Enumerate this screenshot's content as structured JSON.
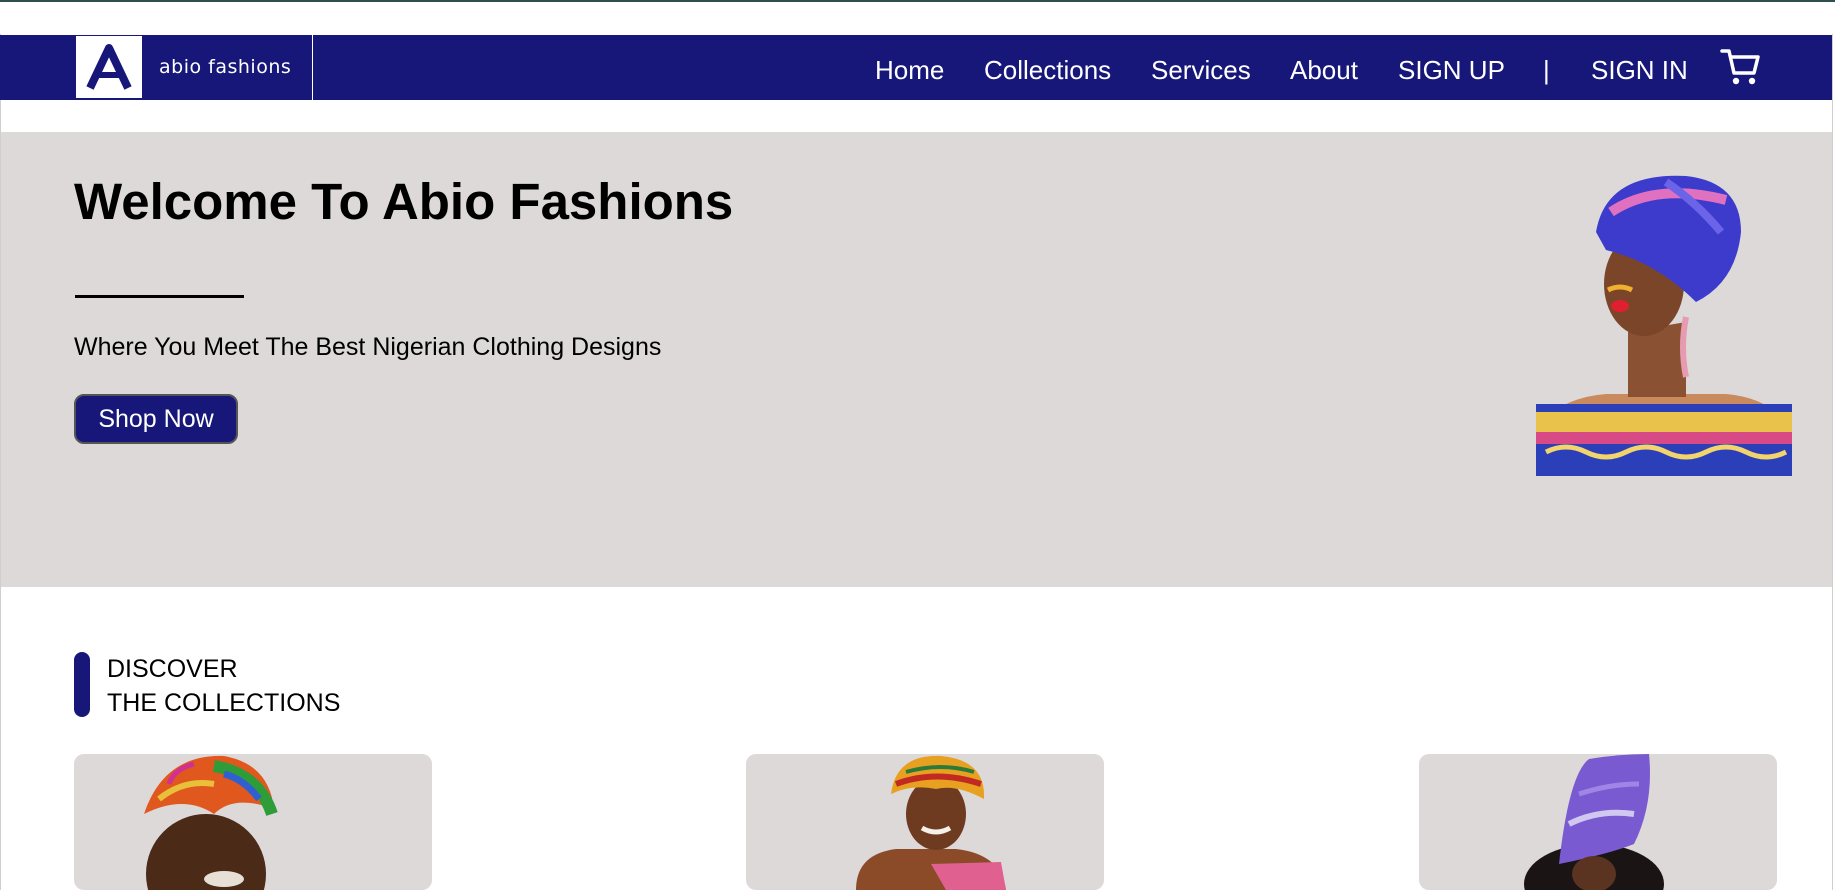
{
  "brand": {
    "logo_letter": "A",
    "name": "abio fashions"
  },
  "nav": {
    "home": "Home",
    "collections": "Collections",
    "services": "Services",
    "about": "About",
    "signup": "SIGN UP",
    "separator": "|",
    "signin": "SIGN IN",
    "cart_icon": "cart-icon"
  },
  "hero": {
    "title": "Welcome To Abio Fashions",
    "subtitle": "Where You Meet The Best Nigerian Clothing Designs",
    "cta_label": "Shop Now"
  },
  "collections": {
    "heading_line1": "DISCOVER",
    "heading_line2": "THE COLLECTIONS"
  },
  "colors": {
    "brand_navy": "#17177a",
    "hero_bg": "#ddd9d9",
    "page_bg": "#ffffff"
  }
}
